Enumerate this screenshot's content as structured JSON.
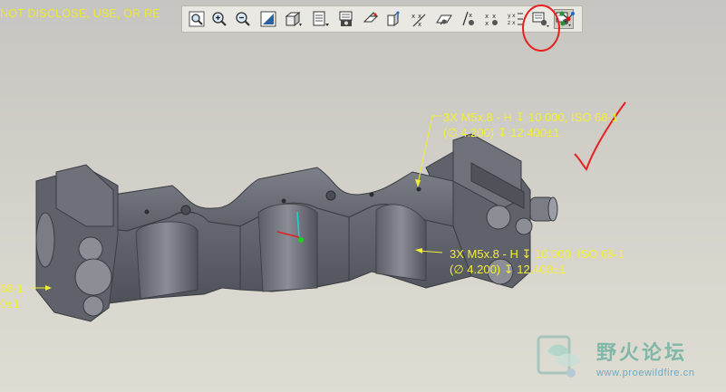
{
  "banner": {
    "text": "NOT DISCLOSE, USE, OR RE"
  },
  "toolbar": {
    "buttons": [
      {
        "name": "zoom-window-icon"
      },
      {
        "name": "zoom-in-icon"
      },
      {
        "name": "zoom-out-icon"
      },
      {
        "name": "refit-icon"
      },
      {
        "name": "reorient-view-icon"
      },
      {
        "name": "saved-views-icon"
      },
      {
        "name": "layers-icon"
      },
      {
        "name": "datum-planes-icon"
      },
      {
        "name": "datum-axes-icon"
      },
      {
        "name": "datum-points-icon"
      },
      {
        "name": "coordinate-systems-icon"
      },
      {
        "name": "annotation-display-icon"
      },
      {
        "name": "spin-center-icon"
      },
      {
        "name": "point-display-icon"
      },
      {
        "name": "xyz-coordinate-display-icon"
      },
      {
        "name": "annotation-plane-display-icon"
      },
      {
        "name": "model-tree-link-icon"
      }
    ],
    "highlighted_button": "annotation-plane-display-icon"
  },
  "annotations": [
    {
      "line1": "3X M5x.8 - H ↧ 10.000, ISO 68-1",
      "line2": "(∅ 4.200) ↧ 12.400±1"
    },
    {
      "line1": "3X M5x.8 - H ↧ 10.000, ISO 68-1",
      "line2": "(∅ 4.200) ↧ 12.400±1"
    },
    {
      "line1": "68-1",
      "line2": "0±1"
    }
  ],
  "watermark": {
    "title": "野火论坛",
    "url": "www.proewildfire.cn"
  },
  "colors": {
    "annotation": "#f2ee38",
    "red_markup": "#e81f1f",
    "model_body": "#6a6d75"
  }
}
